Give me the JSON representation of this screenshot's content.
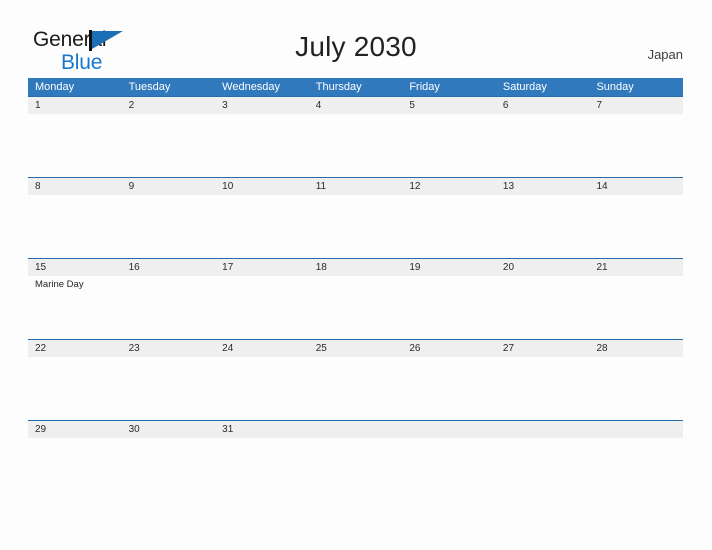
{
  "brand": {
    "word1": "General",
    "word2": "Blue",
    "flag_icon": "flag-triangle-icon",
    "word1_color": "#1a1a1a",
    "word2_color": "#1877cd",
    "flag_color": "#1a6fb5"
  },
  "header": {
    "title": "July 2030",
    "country": "Japan"
  },
  "theme": {
    "header_blue": "#3179bd",
    "row_divider_blue": "#2a6ba8",
    "date_band_gray": "#efefef",
    "page_background": "#fdfdfd",
    "date_text": "#2b2b2b"
  },
  "calendar": {
    "month": "July",
    "year": "2030",
    "weekdays": [
      "Monday",
      "Tuesday",
      "Wednesday",
      "Thursday",
      "Friday",
      "Saturday",
      "Sunday"
    ],
    "weeks": [
      {
        "days": [
          {
            "date": "1",
            "holiday": ""
          },
          {
            "date": "2",
            "holiday": ""
          },
          {
            "date": "3",
            "holiday": ""
          },
          {
            "date": "4",
            "holiday": ""
          },
          {
            "date": "5",
            "holiday": ""
          },
          {
            "date": "6",
            "holiday": ""
          },
          {
            "date": "7",
            "holiday": ""
          }
        ]
      },
      {
        "days": [
          {
            "date": "8",
            "holiday": ""
          },
          {
            "date": "9",
            "holiday": ""
          },
          {
            "date": "10",
            "holiday": ""
          },
          {
            "date": "11",
            "holiday": ""
          },
          {
            "date": "12",
            "holiday": ""
          },
          {
            "date": "13",
            "holiday": ""
          },
          {
            "date": "14",
            "holiday": ""
          }
        ]
      },
      {
        "days": [
          {
            "date": "15",
            "holiday": "Marine Day"
          },
          {
            "date": "16",
            "holiday": ""
          },
          {
            "date": "17",
            "holiday": ""
          },
          {
            "date": "18",
            "holiday": ""
          },
          {
            "date": "19",
            "holiday": ""
          },
          {
            "date": "20",
            "holiday": ""
          },
          {
            "date": "21",
            "holiday": ""
          }
        ]
      },
      {
        "days": [
          {
            "date": "22",
            "holiday": ""
          },
          {
            "date": "23",
            "holiday": ""
          },
          {
            "date": "24",
            "holiday": ""
          },
          {
            "date": "25",
            "holiday": ""
          },
          {
            "date": "26",
            "holiday": ""
          },
          {
            "date": "27",
            "holiday": ""
          },
          {
            "date": "28",
            "holiday": ""
          }
        ]
      },
      {
        "days": [
          {
            "date": "29",
            "holiday": ""
          },
          {
            "date": "30",
            "holiday": ""
          },
          {
            "date": "31",
            "holiday": ""
          },
          {
            "date": "",
            "holiday": ""
          },
          {
            "date": "",
            "holiday": ""
          },
          {
            "date": "",
            "holiday": ""
          },
          {
            "date": "",
            "holiday": ""
          }
        ]
      }
    ]
  }
}
